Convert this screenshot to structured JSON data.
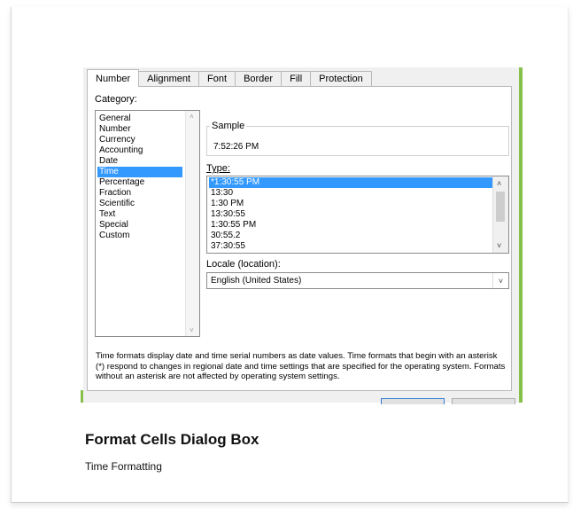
{
  "dialog": {
    "tabs": [
      "Number",
      "Alignment",
      "Font",
      "Border",
      "Fill",
      "Protection"
    ],
    "active_tab": "Number",
    "category_label": "Category:",
    "categories": [
      "General",
      "Number",
      "Currency",
      "Accounting",
      "Date",
      "Time",
      "Percentage",
      "Fraction",
      "Scientific",
      "Text",
      "Special",
      "Custom"
    ],
    "selected_category": "Time",
    "sample_label": "Sample",
    "sample_value": "7:52:26 PM",
    "type_label": "Type:",
    "types": [
      "*1:30:55 PM",
      "13:30",
      "1:30 PM",
      "13:30:55",
      "1:30:55 PM",
      "30:55.2",
      "37:30:55"
    ],
    "selected_type": "*1:30:55 PM",
    "locale_label": "Locale (location):",
    "locale_value": "English (United States)",
    "description": "Time formats display date and time serial numbers as date values.  Time formats that begin with an asterisk (*) respond to changes in regional date and time settings that are specified for the operating system. Formats without an asterisk are not affected by operating system settings."
  },
  "caption": {
    "title": "Format Cells Dialog Box",
    "subtitle": "Time Formatting"
  },
  "colors": {
    "selection": "#3399ff",
    "accent_strip": "#84c04a"
  },
  "icons": {
    "scroll_up": "chevron-up-icon",
    "scroll_down": "chevron-down-icon",
    "dropdown": "chevron-down-icon"
  }
}
